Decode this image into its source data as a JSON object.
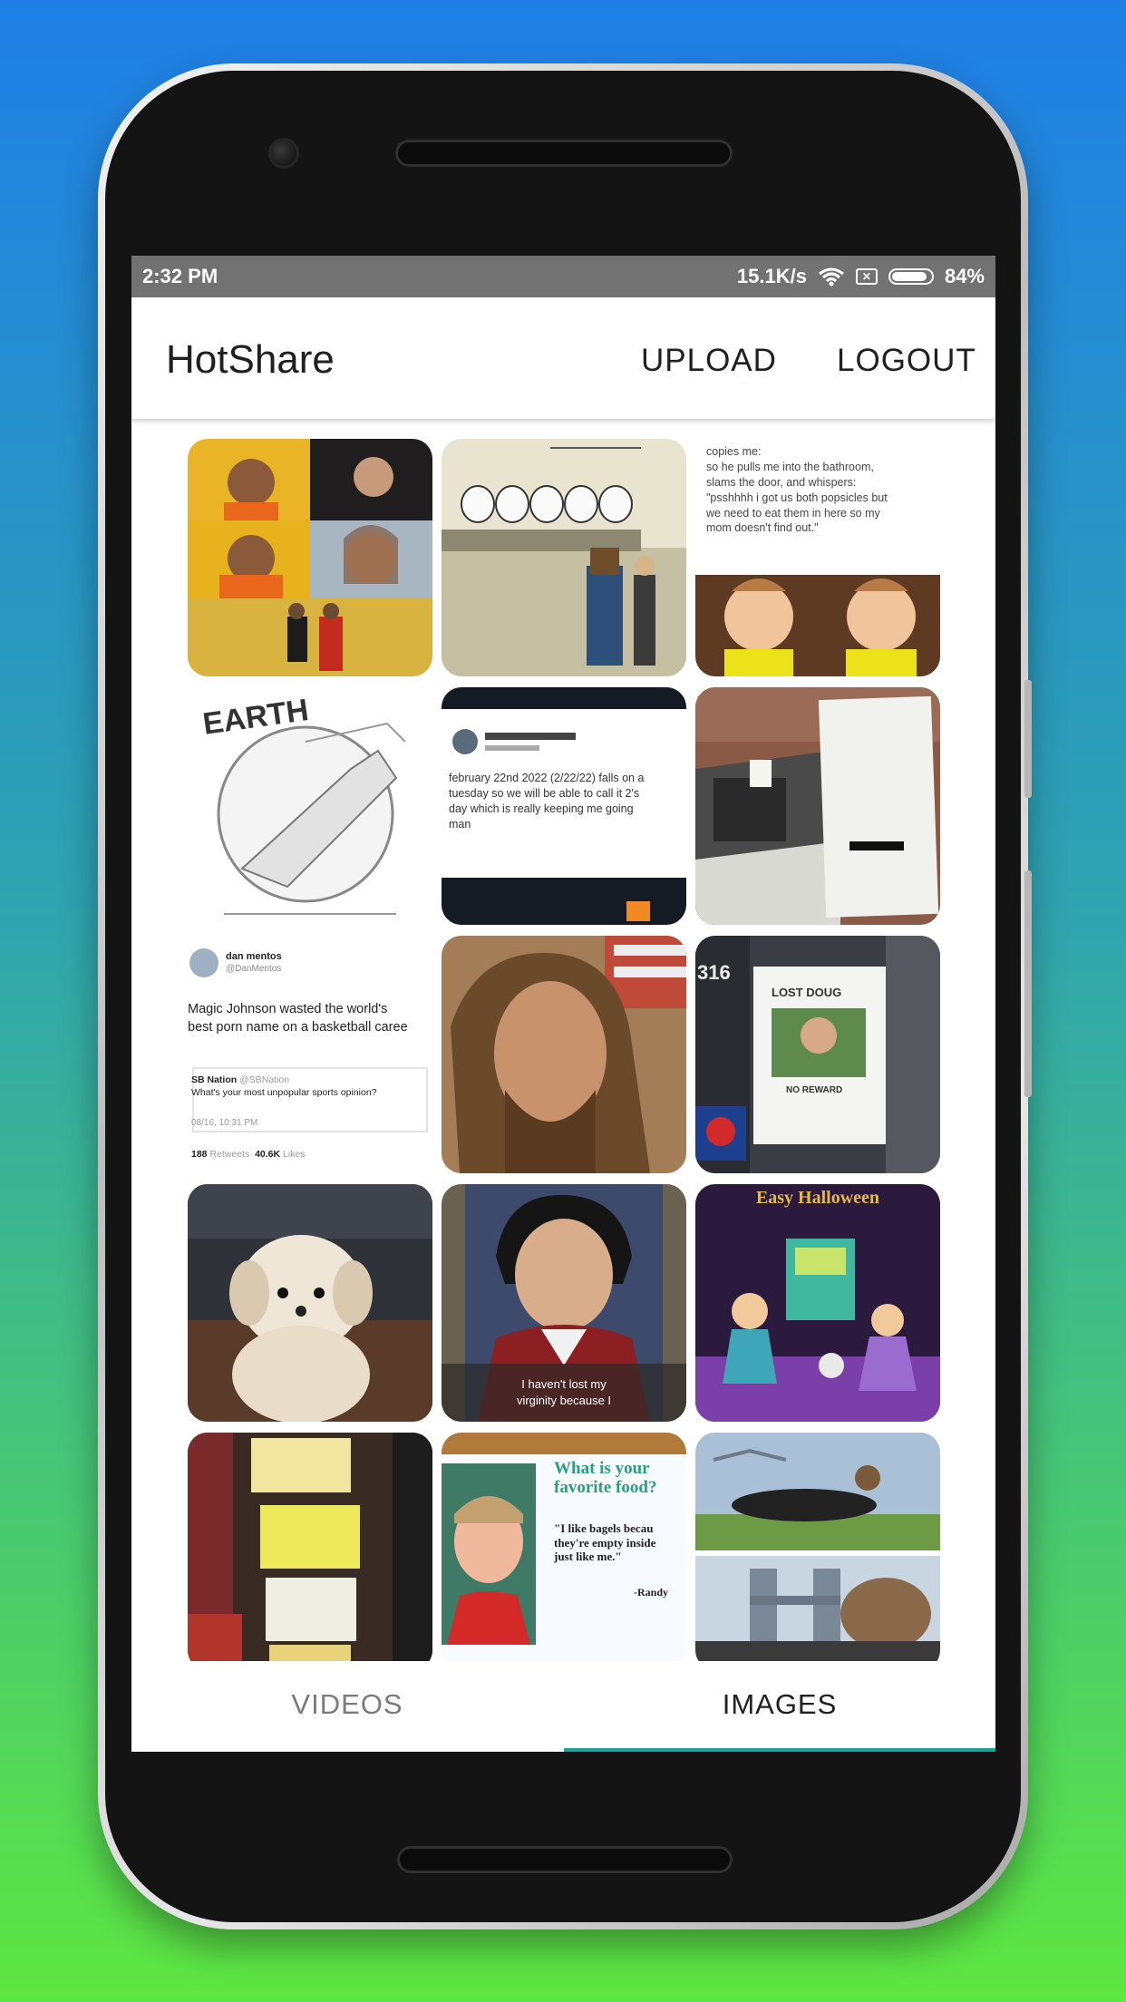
{
  "status_bar": {
    "time": "2:32 PM",
    "speed": "15.1K/s",
    "battery": "84%"
  },
  "app_bar": {
    "title": "HotShare",
    "upload_label": "UPLOAD",
    "logout_label": "LOGOUT"
  },
  "tiles": {
    "t3": {
      "lines": [
        "copies me:",
        "so he pulls me into the bathroom,",
        "slams the door, and whispers:",
        "\"psshhhh i got us both popsicles but",
        "we need to eat them in here so my",
        "mom doesn't find out.\""
      ]
    },
    "t4": {
      "caption": "EARTH"
    },
    "t5": {
      "lines": [
        "february 22nd 2022 (2/22/22) falls on a",
        "tuesday so we will be able to call it 2's",
        "day which is really keeping me going",
        "man"
      ]
    },
    "t7": {
      "name": "dan mentos",
      "handle": "@DanMentos",
      "lines": [
        "Magic Johnson wasted the world's",
        "best porn name on a basketball caree"
      ],
      "quoted_name": "SB Nation",
      "quoted_handle": "@SBNation",
      "quoted_text": "What's your most unpopular sports opinion?",
      "date": "08/16, 10:31 PM",
      "retweets": "188",
      "retweets_label": "Retweets",
      "likes": "40.6K",
      "likes_label": "Likes"
    },
    "t9": {
      "sign_title": "LOST DOUG",
      "sign_sub": "NO REWARD",
      "number": "316"
    },
    "t11": {
      "caption_1": "I haven't lost my",
      "caption_2": "virginity because I"
    },
    "t12": {
      "title": "Easy Halloween"
    },
    "t14": {
      "question_1": "What is your",
      "question_2": "favorite food?",
      "quote_1": "\"I like bagels becau",
      "quote_2": "they're empty inside",
      "quote_3": "just like me.\"",
      "signature": "-Randy"
    }
  },
  "tabs": {
    "videos_label": "VIDEOS",
    "images_label": "IMAGES",
    "active": "images"
  },
  "colors": {
    "tab_indicator": "#1aa59a",
    "status_bar": "#727272"
  }
}
